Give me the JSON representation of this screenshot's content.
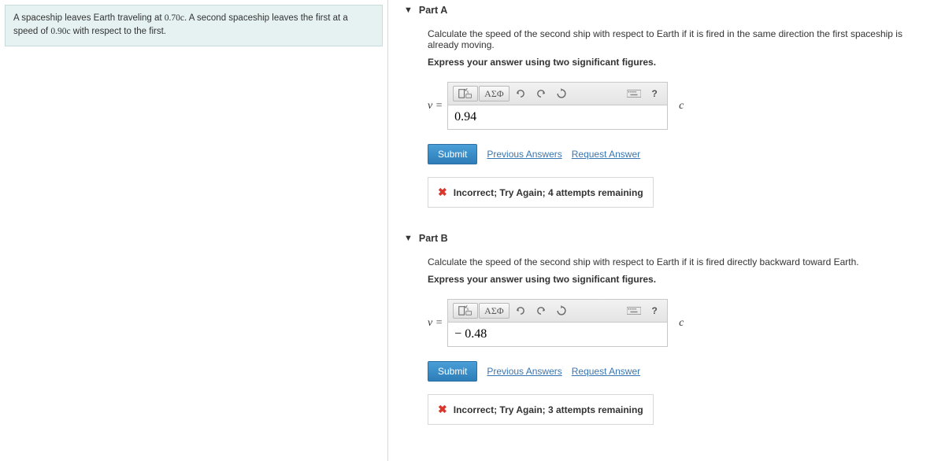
{
  "problem": {
    "text_before_v1": "A spaceship leaves Earth traveling at ",
    "v1": "0.70c",
    "text_mid": ". A second spaceship leaves the first at a speed of ",
    "v2": "0.90c",
    "text_after": " with respect to the first."
  },
  "partA": {
    "label": "Part A",
    "question": "Calculate the speed of the second ship with respect to Earth if it is fired in the same direction the first spaceship is already moving.",
    "instruction": "Express your answer using two significant figures.",
    "var": "v =",
    "value": "0.94",
    "unit": "c",
    "submit": "Submit",
    "prev_answers": "Previous Answers",
    "request_answer": "Request Answer",
    "feedback": "Incorrect; Try Again; 4 attempts remaining",
    "toolbar": {
      "greek": "ΑΣΦ",
      "help": "?"
    }
  },
  "partB": {
    "label": "Part B",
    "question": "Calculate the speed of the second ship with respect to Earth if it is fired directly backward toward Earth.",
    "instruction": "Express your answer using two significant figures.",
    "var": "v =",
    "value": "− 0.48",
    "unit": "c",
    "submit": "Submit",
    "prev_answers": "Previous Answers",
    "request_answer": "Request Answer",
    "feedback": "Incorrect; Try Again; 3 attempts remaining",
    "toolbar": {
      "greek": "ΑΣΦ",
      "help": "?"
    }
  }
}
